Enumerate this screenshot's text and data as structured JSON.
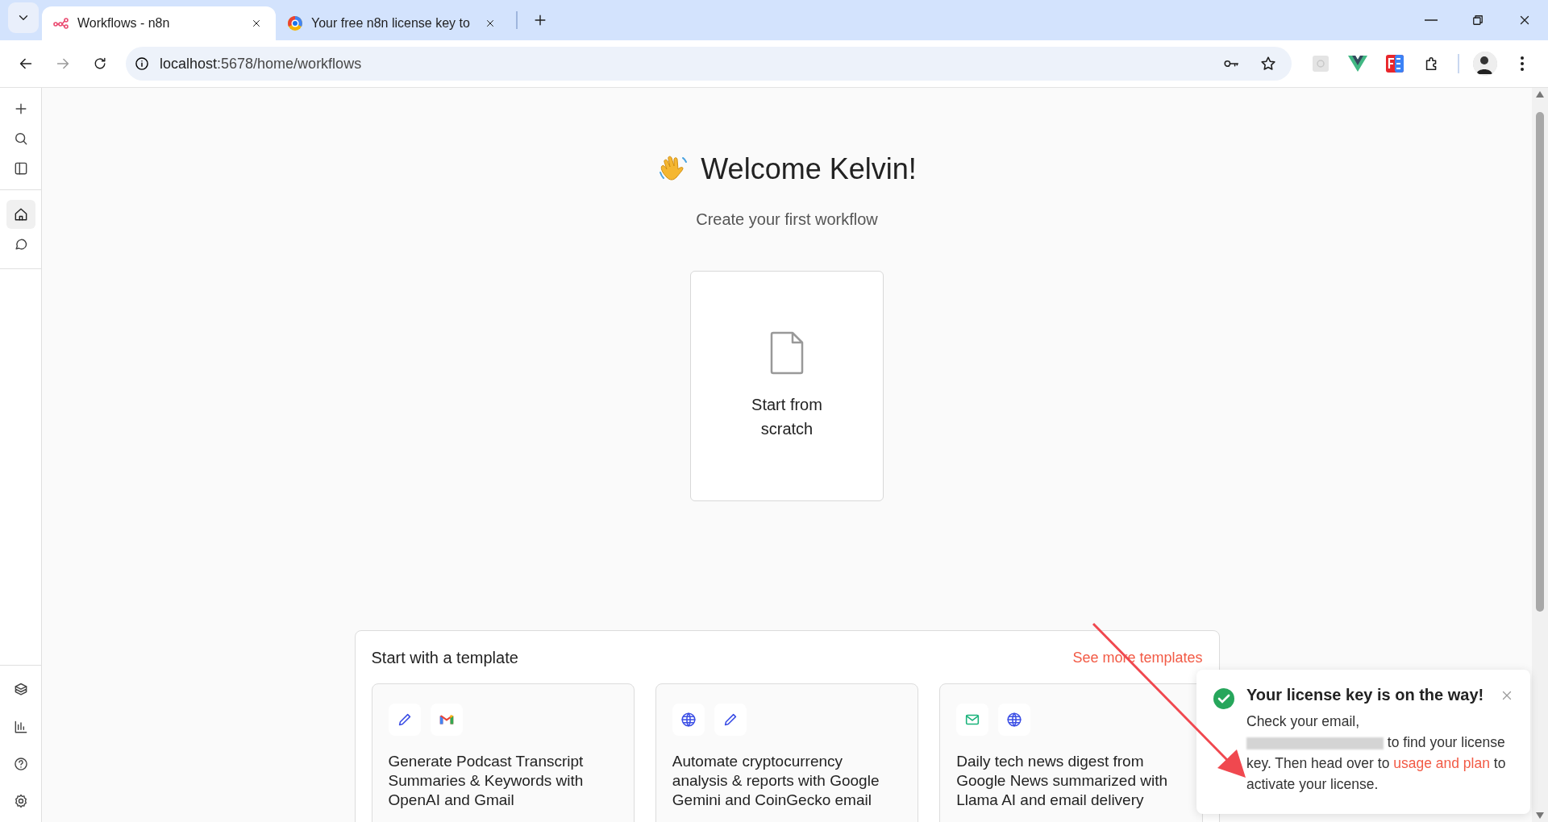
{
  "browser": {
    "tabs": [
      {
        "title": "Workflows - n8n",
        "kind": "n8n",
        "selected": true
      },
      {
        "title": "Your free n8n license key to",
        "kind": "web",
        "selected": false
      }
    ],
    "url_host": "localhost",
    "url_path": ":5678/home/workflows"
  },
  "sidebar": {
    "top_items": [
      {
        "kind": "add",
        "selected": false
      },
      {
        "kind": "search",
        "selected": false
      },
      {
        "kind": "panel",
        "selected": false
      }
    ],
    "main_items": [
      {
        "kind": "home",
        "selected": true
      },
      {
        "kind": "chat",
        "selected": false
      }
    ],
    "bottom_items": [
      {
        "kind": "templates",
        "selected": false
      },
      {
        "kind": "insights",
        "selected": false
      },
      {
        "kind": "help",
        "selected": false
      },
      {
        "kind": "settings",
        "selected": false
      }
    ]
  },
  "welcome": {
    "title": "Welcome Kelvin!",
    "subtitle": "Create your first workflow"
  },
  "start_card": {
    "label": "Start from scratch"
  },
  "templates": {
    "title": "Start with a template",
    "link": "See more templates",
    "items": [
      {
        "icons": [
          {
            "kind": "pencil"
          },
          {
            "kind": "gmail"
          }
        ],
        "title": "Generate Podcast Transcript Summaries & Keywords with OpenAI and Gmail"
      },
      {
        "icons": [
          {
            "kind": "globe"
          },
          {
            "kind": "pencil"
          }
        ],
        "title": "Automate cryptocurrency analysis & reports with Google Gemini and CoinGecko email"
      },
      {
        "icons": [
          {
            "kind": "mail"
          },
          {
            "kind": "globe"
          }
        ],
        "title": "Daily tech news digest from Google News summarized with Llama AI and email delivery"
      }
    ]
  },
  "toast": {
    "title": "Your license key is on the way!",
    "text_1": "Check your email,",
    "text_2": "to find your license key. Then head over to",
    "link": "usage and plan",
    "text_3": "to activate your license."
  }
}
